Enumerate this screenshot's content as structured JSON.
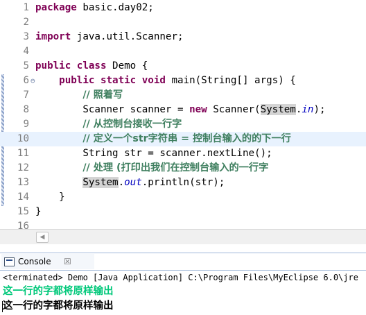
{
  "editor": {
    "lines": [
      {
        "n": "1",
        "tokens": [
          {
            "t": "package",
            "c": "kw"
          },
          {
            "t": " basic.day02;"
          }
        ]
      },
      {
        "n": "2",
        "tokens": []
      },
      {
        "n": "3",
        "tokens": [
          {
            "t": "import",
            "c": "kw"
          },
          {
            "t": " java.util.Scanner;"
          }
        ]
      },
      {
        "n": "4",
        "tokens": []
      },
      {
        "n": "5",
        "tokens": [
          {
            "t": "public",
            "c": "kw"
          },
          {
            "t": " "
          },
          {
            "t": "class",
            "c": "kw"
          },
          {
            "t": " Demo {"
          }
        ]
      },
      {
        "n": "6",
        "ann": "⊖",
        "tokens": [
          {
            "t": "    "
          },
          {
            "t": "public",
            "c": "kw"
          },
          {
            "t": " "
          },
          {
            "t": "static",
            "c": "kw"
          },
          {
            "t": " "
          },
          {
            "t": "void",
            "c": "kw"
          },
          {
            "t": " main(String[] args) {"
          }
        ]
      },
      {
        "n": "7",
        "tokens": [
          {
            "t": "        "
          },
          {
            "t": "// 照着写",
            "c": "cm"
          }
        ]
      },
      {
        "n": "8",
        "tokens": [
          {
            "t": "        Scanner scanner = "
          },
          {
            "t": "new",
            "c": "kw"
          },
          {
            "t": " Scanner("
          },
          {
            "t": "System",
            "c": "sel"
          },
          {
            "t": "."
          },
          {
            "t": "in",
            "c": "fld"
          },
          {
            "t": ");"
          }
        ]
      },
      {
        "n": "9",
        "tokens": [
          {
            "t": "        "
          },
          {
            "t": "// 从控制台接收一行字",
            "c": "cm"
          }
        ]
      },
      {
        "n": "10",
        "current": true,
        "tokens": [
          {
            "t": "        "
          },
          {
            "t": "// 定义一个str字符串 = 控制台输入的的下一行",
            "c": "cm"
          }
        ]
      },
      {
        "n": "11",
        "tokens": [
          {
            "t": "        String str = scanner.nextLine();"
          }
        ]
      },
      {
        "n": "12",
        "tokens": [
          {
            "t": "        "
          },
          {
            "t": "// 处理 (打印出我们在控制台输入的一行字",
            "c": "cm"
          }
        ]
      },
      {
        "n": "13",
        "tokens": [
          {
            "t": "        "
          },
          {
            "t": "System",
            "c": "sel"
          },
          {
            "t": "."
          },
          {
            "t": "out",
            "c": "fld"
          },
          {
            "t": ".println(str);"
          }
        ]
      },
      {
        "n": "14",
        "tokens": [
          {
            "t": "    }"
          }
        ]
      },
      {
        "n": "15",
        "tokens": [
          {
            "t": "}"
          }
        ]
      },
      {
        "n": "16",
        "tokens": []
      }
    ]
  },
  "console": {
    "tab_label": "Console",
    "close_glyph": "☒",
    "status": "<terminated> Demo [Java Application] C:\\Program Files\\MyEclipse 6.0\\jre",
    "input_echo": "这一行的字都将原样输出",
    "output": "这一行的字都将原样输出"
  },
  "icons": {
    "scroll_left": "◀",
    "console": "console-icon",
    "close": "close-icon"
  },
  "colors": {
    "keyword": "#7f0055",
    "comment": "#3f7f5f",
    "field": "#0000c0",
    "current_line": "#e8f2fe",
    "console_input": "#00c87a"
  }
}
